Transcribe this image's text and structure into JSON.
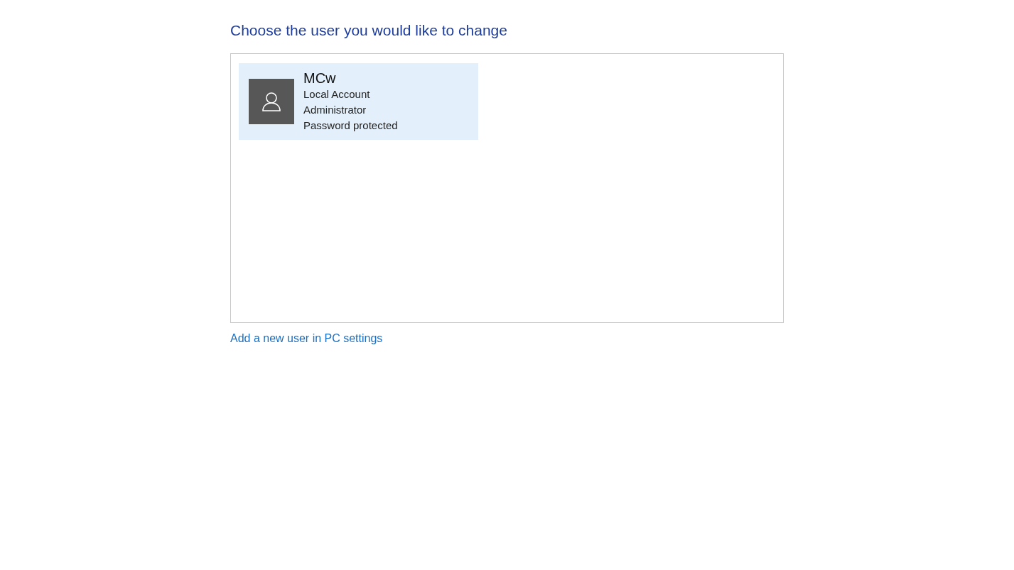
{
  "heading": "Choose the user you would like to change",
  "users": [
    {
      "name": "MCw",
      "details": [
        "Local Account",
        "Administrator",
        "Password protected"
      ],
      "selected": true
    }
  ],
  "link": "Add a new user in PC settings"
}
